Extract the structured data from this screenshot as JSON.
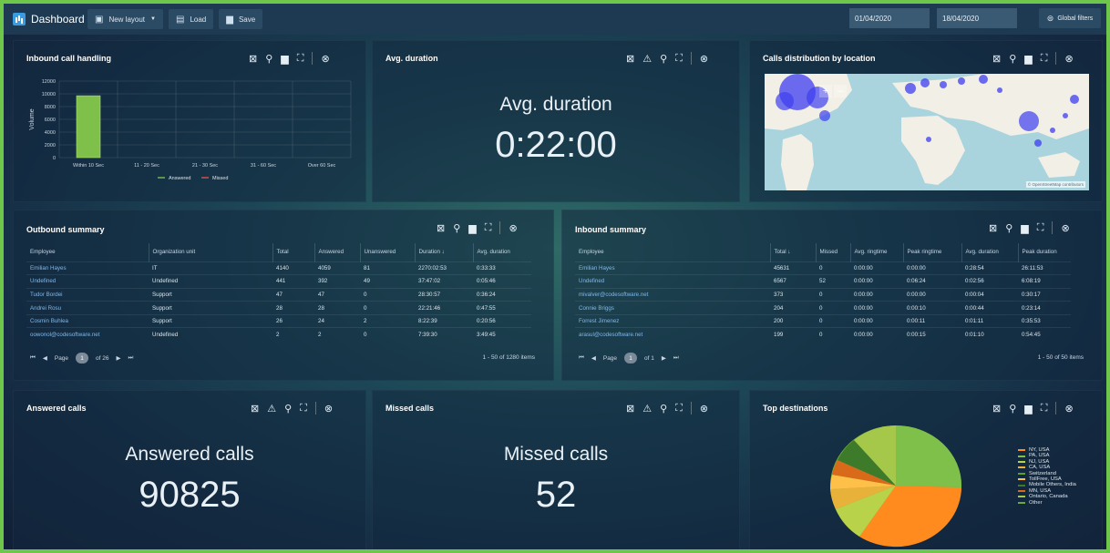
{
  "topbar": {
    "title": "Dashboard",
    "new_layout": "New layout",
    "load": "Load",
    "save": "Save",
    "date_from": "01/04/2020",
    "date_to": "18/04/2020",
    "global_filters": "Global filters"
  },
  "inbound_handling": {
    "title": "Inbound call handling",
    "ylabel": "Volume",
    "legend_answered": "Answered",
    "legend_missed": "Missed"
  },
  "chart_data": {
    "type": "bar",
    "title": "Inbound call handling",
    "categories": [
      "Within 10 Sec",
      "11 - 20 Sec",
      "21 - 30 Sec",
      "31 - 60 Sec",
      "Over 60 Sec"
    ],
    "series": [
      {
        "name": "Answered",
        "values": [
          9700,
          0,
          0,
          0,
          0
        ],
        "color": "#7ec04a"
      },
      {
        "name": "Missed",
        "values": [
          0,
          0,
          0,
          0,
          0
        ],
        "color": "#d9534f"
      }
    ],
    "ylabel": "Volume",
    "yticks": [
      0,
      2000,
      4000,
      6000,
      8000,
      10000,
      12000
    ],
    "ylim": [
      0,
      12000
    ],
    "grid": true,
    "legend": "bottom"
  },
  "avg_duration": {
    "title": "Avg. duration",
    "label": "Avg. duration",
    "value": "0:22:00"
  },
  "map": {
    "title": "Calls distribution by location",
    "attribution": "© OpenStreetMap contributors",
    "zoom_in": "+",
    "zoom_out": "–"
  },
  "outbound": {
    "title": "Outbound summary",
    "columns": [
      "Employee",
      "Organization unit",
      "Total",
      "Answered",
      "Unanswered",
      "Duration ↓",
      "Avg. duration"
    ],
    "rows": [
      [
        "Emilian Hayes",
        "IT",
        "4140",
        "4059",
        "81",
        "2270:02:53",
        "0:33:33"
      ],
      [
        "Undefined",
        "Undefined",
        "441",
        "392",
        "49",
        "37:47:02",
        "0:05:46"
      ],
      [
        "Tudor Bordei",
        "Support",
        "47",
        "47",
        "0",
        "28:30:57",
        "0:36:24"
      ],
      [
        "Andrei Rosu",
        "Support",
        "28",
        "28",
        "0",
        "22:21:46",
        "0:47:55"
      ],
      [
        "Cosmin Buhlea",
        "Support",
        "26",
        "24",
        "2",
        "8:22:39",
        "0:20:56"
      ],
      [
        "oowonol@codesoftware.net",
        "Undefined",
        "2",
        "2",
        "0",
        "7:39:30",
        "3:49:45"
      ]
    ],
    "pager_page_label": "Page",
    "pager_page": "1",
    "pager_of": "of 26",
    "pager_info": "1 - 50 of 1280 items"
  },
  "inbound": {
    "title": "Inbound summary",
    "columns": [
      "Employee",
      "Total ↓",
      "Missed",
      "Avg. ringtime",
      "Peak ringtime",
      "Avg. duration",
      "Peak duration"
    ],
    "rows": [
      [
        "Emilian Hayes",
        "45631",
        "0",
        "0:00:00",
        "0:00:00",
        "0:28:54",
        "26:11:53"
      ],
      [
        "Undefined",
        "6567",
        "52",
        "0:00:00",
        "0:06:24",
        "0:02:56",
        "6:08:19"
      ],
      [
        "mivalver@codesoftware.net",
        "373",
        "0",
        "0:00:00",
        "0:00:00",
        "0:00:04",
        "0:30:17"
      ],
      [
        "Connie Briggs",
        "204",
        "0",
        "0:00:00",
        "0:00:10",
        "0:00:44",
        "0:23:14"
      ],
      [
        "Forrest Jimenez",
        "200",
        "0",
        "0:00:00",
        "0:00:11",
        "0:01:11",
        "0:35:53"
      ],
      [
        "arasul@codesoftware.net",
        "199",
        "0",
        "0:00:00",
        "0:00:15",
        "0:01:10",
        "0:54:45"
      ]
    ],
    "pager_page_label": "Page",
    "pager_page": "1",
    "pager_of": "of 1",
    "pager_info": "1 - 50 of 50 items"
  },
  "answered": {
    "title": "Answered calls",
    "label": "Answered calls",
    "value": "90825"
  },
  "missed": {
    "title": "Missed calls",
    "label": "Missed calls",
    "value": "52"
  },
  "top_destinations": {
    "title": "Top destinations",
    "legend": [
      {
        "label": "NY, USA",
        "color": "#ff8a1e"
      },
      {
        "label": "PA, USA",
        "color": "#7ec04a"
      },
      {
        "label": "NJ, USA",
        "color": "#b8d34a"
      },
      {
        "label": "CA, USA",
        "color": "#e8b23a"
      },
      {
        "label": "Switzerland",
        "color": "#5aa02c"
      },
      {
        "label": "TollFree, USA",
        "color": "#ffc04a"
      },
      {
        "label": "Mobile Others, India",
        "color": "#3d7a2a"
      },
      {
        "label": "MN, USA",
        "color": "#d86a1a"
      },
      {
        "label": "Ontario, Canada",
        "color": "#a6c84a"
      },
      {
        "label": "Other",
        "color": "#6aa83a"
      }
    ]
  }
}
